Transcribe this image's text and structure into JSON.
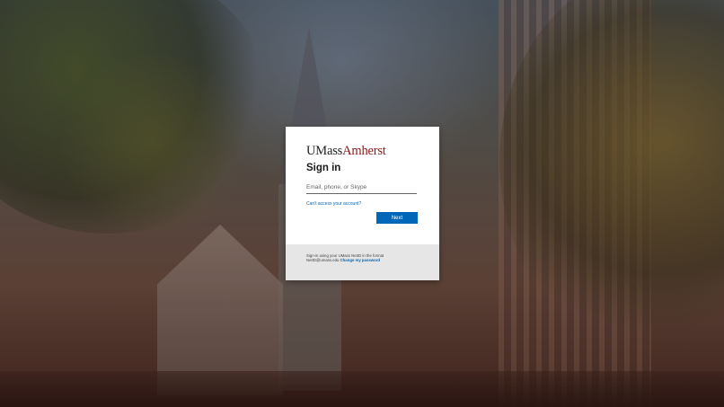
{
  "logo": {
    "part1": "UMass",
    "part2": "Amherst"
  },
  "signin": {
    "title": "Sign in",
    "email_placeholder": "Email, phone, or Skype",
    "email_value": "",
    "cant_access_link": "Can't access your account?",
    "next_label": "Next"
  },
  "footer": {
    "line1": "Sign-in using your UMass NetID in the format",
    "line2": "NetID@umass.edu",
    "change_password_link": "Change my password"
  },
  "colors": {
    "brand_maroon": "#881c1c",
    "accent_blue": "#0067b8",
    "footer_gray": "#e6e6e6"
  }
}
